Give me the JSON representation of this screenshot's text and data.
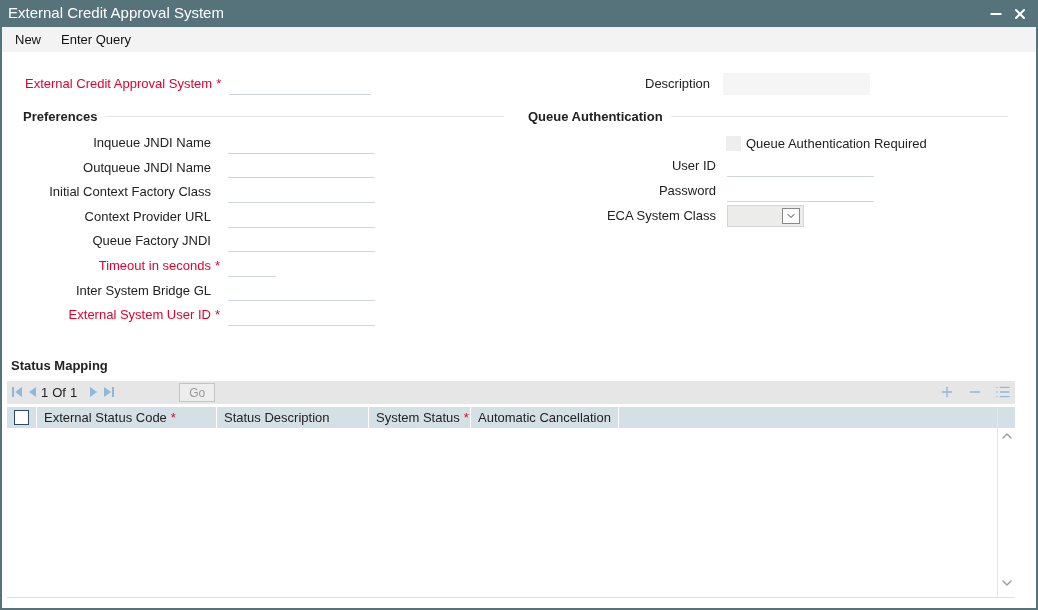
{
  "window": {
    "title": "External Credit Approval System"
  },
  "toolbar": [
    "New",
    "Enter Query"
  ],
  "header": {
    "main": {
      "label": "External Credit Approval System",
      "required": true,
      "mark": "*"
    },
    "description": {
      "label": "Description"
    }
  },
  "preferences": {
    "title": "Preferences",
    "fields": [
      {
        "label": "Inqueue JNDI Name",
        "required": false,
        "kind": "text"
      },
      {
        "label": "Outqueue JNDI Name",
        "required": false,
        "kind": "text"
      },
      {
        "label": "Initial Context Factory Class",
        "required": false,
        "kind": "text"
      },
      {
        "label": "Context Provider URL",
        "required": false,
        "kind": "text"
      },
      {
        "label": "Queue Factory JNDI",
        "required": false,
        "kind": "text"
      },
      {
        "label": "Timeout in seconds",
        "required": true,
        "mark": "*",
        "kind": "short"
      },
      {
        "label": "Inter System Bridge GL",
        "required": false,
        "kind": "text"
      },
      {
        "label": "External System User ID",
        "required": true,
        "mark": "*",
        "kind": "text"
      }
    ]
  },
  "queue_authentication": {
    "title": "Queue Authentication",
    "checkbox": {
      "label": "Queue Authentication Required",
      "checked": false
    },
    "fields": [
      {
        "label": "User ID",
        "kind": "text"
      },
      {
        "label": "Password",
        "kind": "text"
      },
      {
        "label": "ECA System Class",
        "kind": "select"
      }
    ]
  },
  "status_mapping": {
    "title": "Status Mapping",
    "pager": {
      "page": "1",
      "of": "Of",
      "total": "1",
      "go": "Go"
    },
    "select_all": {
      "checked": false
    },
    "columns": [
      {
        "label": "External Status Code",
        "required": true,
        "mark": "*"
      },
      {
        "label": "Status Description",
        "required": false
      },
      {
        "label": "System Status",
        "required": true,
        "mark": "*"
      },
      {
        "label": "Automatic Cancellation",
        "required": false
      }
    ]
  }
}
